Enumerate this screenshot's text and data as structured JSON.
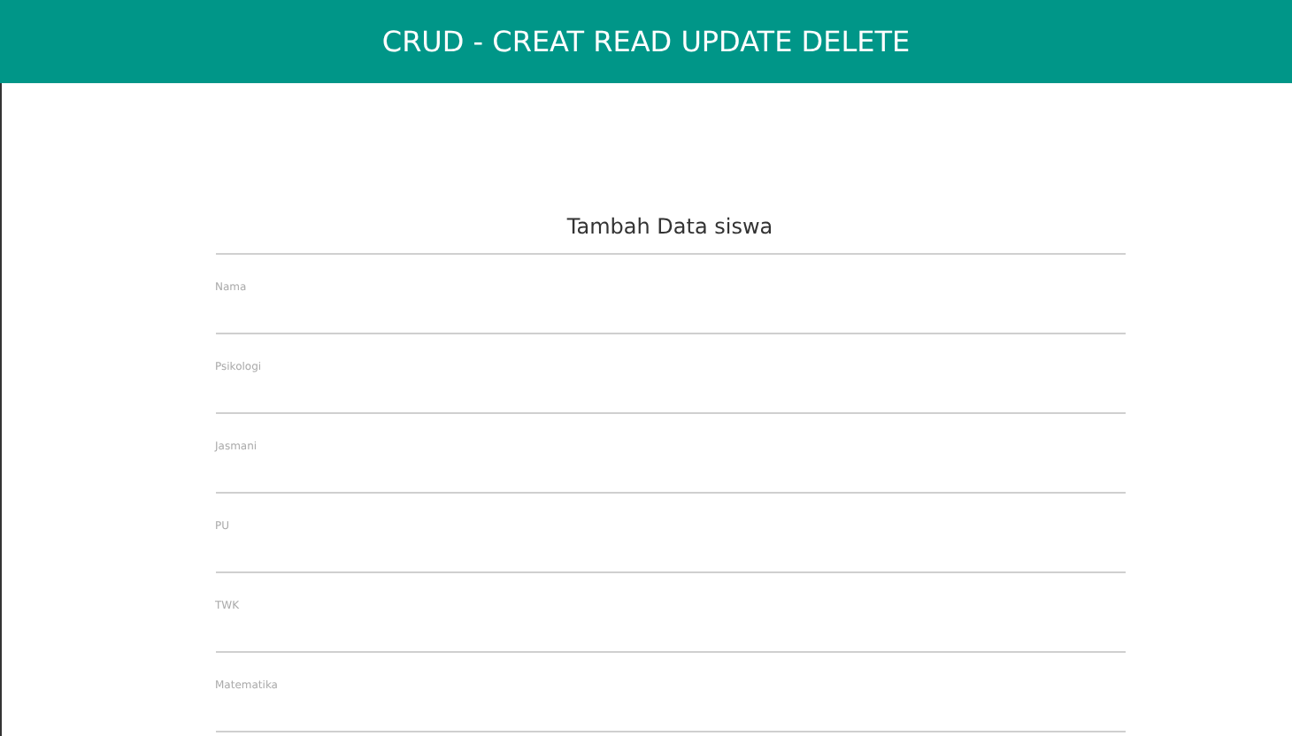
{
  "header": {
    "title": "CRUD - CREAT READ UPDATE DELETE"
  },
  "form": {
    "title": "Tambah Data siswa",
    "fields": [
      {
        "label": "Nama"
      },
      {
        "label": "Psikologi"
      },
      {
        "label": "Jasmani"
      },
      {
        "label": "PU"
      },
      {
        "label": "TWK"
      },
      {
        "label": "Matematika"
      }
    ]
  }
}
